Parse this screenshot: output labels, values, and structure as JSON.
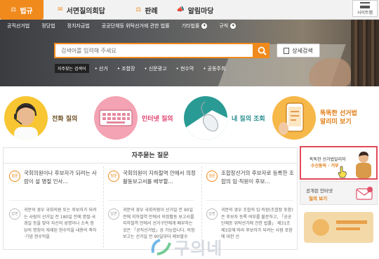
{
  "topbar": {
    "tabs": [
      {
        "label": "법규",
        "icon": "gavel-icon",
        "active": true
      },
      {
        "label": "서면질의회답",
        "icon": "mail-icon",
        "active": false
      },
      {
        "label": "판례",
        "icon": "scales-icon",
        "active": false
      },
      {
        "label": "알림마당",
        "icon": "megaphone-icon",
        "active": false
      }
    ],
    "sitemap_label": "사이트맵"
  },
  "nav": {
    "items": [
      "공직선거법",
      "정당법",
      "정치자금법",
      "공공단체등 위탁선거에 관한 법률",
      "기타법률",
      "규칙"
    ],
    "expandable_index": [
      4,
      5
    ]
  },
  "search": {
    "placeholder": "검색어를 입력해 주세요",
    "detail_label": "상세검색",
    "keywords_label": "자주찾는 검색어",
    "keywords": [
      "선거",
      "조합장",
      "신문광고",
      "현수막",
      "공동주최"
    ]
  },
  "quick_menu": [
    {
      "label": "전화 질의",
      "icon": "headset-operator-icon"
    },
    {
      "label": "인터넷 질의",
      "icon": "keyboard-icon"
    },
    {
      "label": "내 질의 조회",
      "icon": "mouse-icon"
    },
    {
      "label_line1": "똑똑한 선거법",
      "label_line2": "알리미 보기",
      "icon": "phone-notice-icon"
    }
  ],
  "faq": {
    "title": "자주묻는 질문",
    "q_badge": "질문",
    "a_badge": "답변",
    "items": [
      {
        "q": "국회의원이나 후보자가 되려는 사람이 설 명절 인사...",
        "a": "귀문의 경우 국회의원 또는 후보자가 되려는 사람이 선거일 전 180일 전에 명절·국경일 등을 맞아 자신의 성명이나 소속 정당의 명칭이 게재된 현수막을 내용의 축하·기념 현수막을"
      },
      {
        "q": "국회의원이 지하철역 안에서 의정활동보고서를 배부할...",
        "a": "귀문의 경우 국회의원이 선거일 전 90일 전에 지하철역 안에서 의정활동 보고서를 지하철역 안에서 선거구민에게 배부하는 것은 「공직선거법」상 가능합니다. 의정보고는 선거일 전 90일부터 제보할수"
      },
      {
        "q": "조합장선거의 후보자로 등록한 조합의 임·직원이 후보...",
        "a": "귀문의 경우 조합의 임·직원(조합장 포함)은 후보자 등록 여부를 불문하고, 「공공단체등 위탁선거에 관한 법률」 제31조 제3호에 따라 후보자가 되려는 사람 포함에 대한 선"
      }
    ]
  },
  "banners": {
    "alimi_line1": "똑똑한 선거법알리미",
    "alimi_line2": "수신동의 · 거부",
    "internet_line1": "공개된 인터넷",
    "internet_line2": "질의 보기"
  },
  "watermark": "구의네",
  "colors": {
    "accent": "#f08a1c",
    "pink": "#e0406c",
    "teal": "#2a8e8e"
  }
}
